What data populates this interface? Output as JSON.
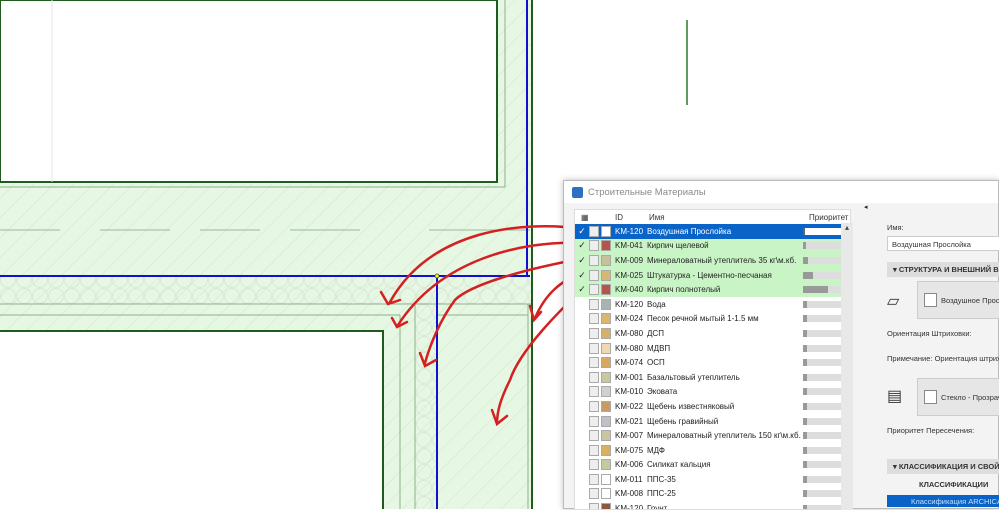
{
  "dialog": {
    "title": "Строительные Материалы"
  },
  "columns": {
    "id": "ID",
    "name": "Имя",
    "priority": "Приоритет"
  },
  "materials": [
    {
      "id": "KM-120",
      "name": "Воздушная Прослойка",
      "color": "#ffffff",
      "priority": 0.05,
      "checked": true,
      "state": "selected"
    },
    {
      "id": "KM-041",
      "name": "Кирпич щелевой",
      "color": "#b5544a",
      "priority": 0.08,
      "checked": true,
      "state": "used"
    },
    {
      "id": "KM-009",
      "name": "Минераловатный утеплитель 35 кг\\м.кб.",
      "color": "#c8c09a",
      "priority": 0.12,
      "checked": true,
      "state": "used"
    },
    {
      "id": "KM-025",
      "name": "Штукатурка - Цементно-песчаная",
      "color": "#d8b870",
      "priority": 0.25,
      "checked": true,
      "state": "used"
    },
    {
      "id": "KM-040",
      "name": "Кирпич полнотелый",
      "color": "#b5544a",
      "priority": 0.62,
      "checked": true,
      "state": "used"
    },
    {
      "id": "KM-120",
      "name": "Вода",
      "color": "#a8b4b4",
      "priority": 0.1,
      "checked": false,
      "state": ""
    },
    {
      "id": "KM-024",
      "name": "Песок речной мытый 1-1.5 мм",
      "color": "#d8b870",
      "priority": 0.1,
      "checked": false,
      "state": ""
    },
    {
      "id": "KM-080",
      "name": "ДСП",
      "color": "#d6b068",
      "priority": 0.1,
      "checked": false,
      "state": ""
    },
    {
      "id": "KM-080",
      "name": "МДВП",
      "color": "#f0d8b0",
      "priority": 0.1,
      "checked": false,
      "state": ""
    },
    {
      "id": "KM-074",
      "name": "ОСП",
      "color": "#d8a860",
      "priority": 0.1,
      "checked": false,
      "state": ""
    },
    {
      "id": "KM-001",
      "name": "Базальтовый утеплитель",
      "color": "#c8c8a0",
      "priority": 0.1,
      "checked": false,
      "state": ""
    },
    {
      "id": "KM-010",
      "name": "Эковата",
      "color": "#d0d0d0",
      "priority": 0.1,
      "checked": false,
      "state": ""
    },
    {
      "id": "KM-022",
      "name": "Щебень известняковый",
      "color": "#c89a68",
      "priority": 0.1,
      "checked": false,
      "state": ""
    },
    {
      "id": "KM-021",
      "name": "Щебень гравийный",
      "color": "#c0c0c8",
      "priority": 0.1,
      "checked": false,
      "state": ""
    },
    {
      "id": "KM-007",
      "name": "Минераловатный утеплитель 150 кг\\м.кб.",
      "color": "#c8c8a0",
      "priority": 0.1,
      "checked": false,
      "state": ""
    },
    {
      "id": "KM-075",
      "name": "МДФ",
      "color": "#d8b060",
      "priority": 0.1,
      "checked": false,
      "state": ""
    },
    {
      "id": "KM-006",
      "name": "Силикат кальция",
      "color": "#c8c8a0",
      "priority": 0.1,
      "checked": false,
      "state": ""
    },
    {
      "id": "KM-011",
      "name": "ППС-35",
      "color": "#ffffff",
      "priority": 0.1,
      "checked": false,
      "state": ""
    },
    {
      "id": "KM-008",
      "name": "ППС-25",
      "color": "#ffffff",
      "priority": 0.1,
      "checked": false,
      "state": ""
    },
    {
      "id": "KM-120",
      "name": "Грунт",
      "color": "#8a5a3a",
      "priority": 0.1,
      "checked": false,
      "state": ""
    }
  ],
  "panel": {
    "name_label": "Имя:",
    "name_value": "Воздушная Прослойка",
    "section_structure": "▾ СТРУКТУРА И ВНЕШНИЙ ВИД",
    "fill_value": "Воздушное Пространство",
    "hatch_orientation_label": "Ориентация Штриховки:",
    "note_label": "Примечание: Ориентация штриховки",
    "surface_value": "Стекло - Прозрачное",
    "intersection_priority_label": "Приоритет Пересечения:",
    "section_classification": "▾ КЛАССИФИКАЦИЯ И СВОЙСТВА",
    "classification_header": "КЛАССИФИКАЦИИ",
    "classification_item": "Классификация ARCHICAD"
  },
  "colors": {
    "accent": "#0a64c8",
    "used_row": "#c9f5c6",
    "wall_fill": "#e6f7e4",
    "annotation": "#d42020"
  }
}
